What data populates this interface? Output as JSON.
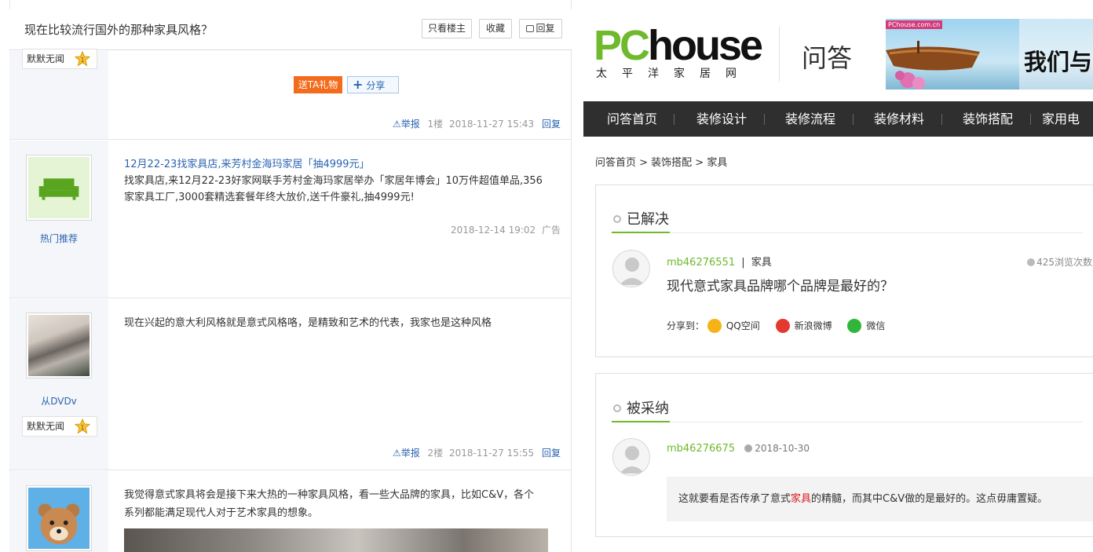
{
  "left": {
    "thread_title": "现在比较流行国外的那种家具风格？",
    "buttons": {
      "only_op": "只看楼主",
      "favorite": "收藏",
      "reply": "回复"
    },
    "post0": {
      "rank_text": "默默无闻",
      "gift_button": "送TA礼物",
      "share_button": "分享",
      "report": "举报",
      "floor": "1楼",
      "time": "2018-11-27 15:43",
      "reply": "回复"
    },
    "ad_post": {
      "side_label": "热门推荐",
      "title": "12月22-23找家具店,来芳村金海玛家居「抽4999元」",
      "body_line1": "找家具店,来12月22-23好家网联手芳村金海玛家居举办「家居年博会」10万件超值单品,356",
      "body_line2": "家家具工厂,3000套精选套餐年终大放价,送千件豪礼,抽4999元!",
      "time": "2018-12-14 19:02",
      "tag": "广告"
    },
    "post2": {
      "username": "从DVDv",
      "rank_text": "默默无闻",
      "body": "现在兴起的意大利风格就是意式风格咯，是精致和艺术的代表，我家也是这种风格",
      "report": "举报",
      "floor": "2楼",
      "time": "2018-11-27 15:55",
      "reply": "回复"
    },
    "post3": {
      "body_line1": "我觉得意式家具将会是接下来大热的一种家具风格，看一些大品牌的家具，比如C&V，各个",
      "body_line2": "系列都能满足现代人对于艺术家具的想象。"
    }
  },
  "right": {
    "logo": {
      "pc": "PC",
      "house": "house",
      "sub": "太平洋家居网",
      "section": "问答"
    },
    "banner": {
      "tag": "PChouse.com.cn",
      "text": "我们与"
    },
    "nav": [
      "问答首页",
      "装修设计",
      "装修流程",
      "装修材料",
      "装饰搭配",
      "家用电"
    ],
    "breadcrumb": "问答首页 > 装饰搭配 > 家具",
    "solved": {
      "heading": "已解决",
      "user": "mb46276551",
      "sep": "|",
      "category": "家具",
      "views": "425浏览次数",
      "question": "现代意式家具品牌哪个品牌是最好的？",
      "share_label": "分享到：",
      "share_items": [
        "QQ空间",
        "新浪微博",
        "微信"
      ]
    },
    "adopted": {
      "heading": "被采纳",
      "user": "mb46276675",
      "date": "2018-10-30",
      "answer_pre": "这就要看是否传承了意式",
      "answer_highlight": "家具",
      "answer_post": "的精髓，而其中C&V做的是最好的。这点毋庸置疑。"
    }
  },
  "colors": {
    "green": "#6fb92c",
    "link_blue": "#2a63b0",
    "nav_bg": "#2f2f2f",
    "gift_orange": "#f36b1c",
    "highlight_red": "#d71a1a"
  }
}
